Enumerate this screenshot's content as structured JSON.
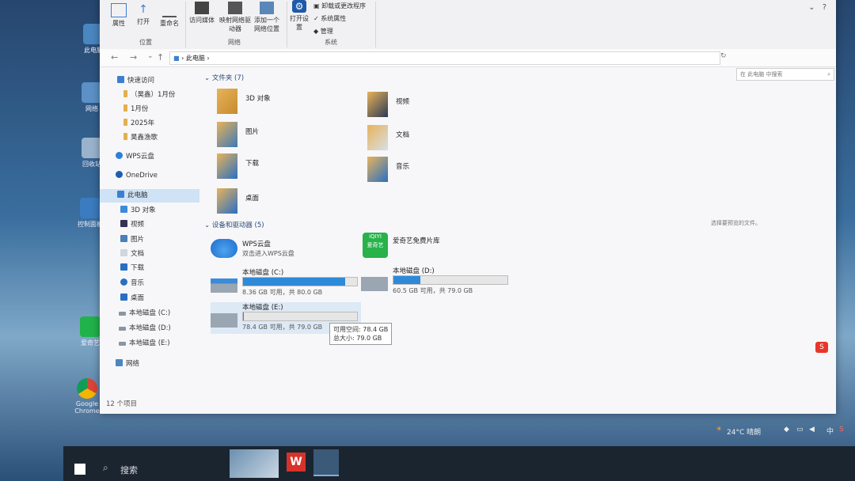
{
  "desktop": {
    "icons": [
      "此电脑",
      "网络",
      "回收站",
      "控制面板",
      "爱奇艺",
      "Google Chrome"
    ]
  },
  "ribbon": {
    "buttons": [
      "属性",
      "打开",
      "重命名",
      "访问媒体",
      "映射网络驱动器",
      "添加一个网络位置",
      "打开设置"
    ],
    "small_items": [
      "卸载或更改程序",
      "系统属性",
      "管理"
    ],
    "groups": [
      "位置",
      "网络",
      "系统"
    ]
  },
  "address_bar": {
    "path": [
      "此电脑"
    ],
    "search_placeholder": "在 此电脑 中搜索"
  },
  "nav_pane": {
    "items": [
      {
        "label": "快速访问",
        "icon": "star-icon"
      },
      {
        "label": "（昊鑫）1月份",
        "icon": "folder-icon"
      },
      {
        "label": "1月份",
        "icon": "folder-icon"
      },
      {
        "label": "2025年",
        "icon": "folder-icon"
      },
      {
        "label": "昊鑫渔歌",
        "icon": "folder-icon"
      },
      {
        "label": "WPS云盘",
        "icon": "cloud-icon"
      },
      {
        "label": "OneDrive",
        "icon": "cloud-icon"
      },
      {
        "label": "此电脑",
        "icon": "computer-icon",
        "selected": true
      },
      {
        "label": "3D 对象",
        "icon": "cube-icon"
      },
      {
        "label": "视频",
        "icon": "video-icon"
      },
      {
        "label": "图片",
        "icon": "picture-icon"
      },
      {
        "label": "文档",
        "icon": "document-icon"
      },
      {
        "label": "下载",
        "icon": "download-icon"
      },
      {
        "label": "音乐",
        "icon": "music-icon"
      },
      {
        "label": "桌面",
        "icon": "desktop-icon"
      },
      {
        "label": "本地磁盘 (C:)",
        "icon": "drive-icon"
      },
      {
        "label": "本地磁盘 (D:)",
        "icon": "drive-icon"
      },
      {
        "label": "本地磁盘 (E:)",
        "icon": "drive-icon"
      },
      {
        "label": "网络",
        "icon": "network-icon"
      }
    ]
  },
  "folders_section": {
    "header": "文件夹 (7)",
    "items": [
      "3D 对象",
      "视频",
      "图片",
      "文档",
      "下载",
      "音乐",
      "桌面"
    ]
  },
  "devices_section": {
    "header": "设备和驱动器 (5)",
    "wps": {
      "name": "WPS云盘",
      "sub": "双击进入WPS云盘"
    },
    "iqiyi": {
      "name": "爱奇艺免费片库",
      "logo_text": "iQIYI",
      "logo_sub": "爱奇艺"
    },
    "drives": [
      {
        "name": "本地磁盘 (C:)",
        "info": "8.36 GB 可用，共 80.0 GB",
        "used_fraction": 0.895
      },
      {
        "name": "本地磁盘 (D:)",
        "info": "60.5 GB 可用，共 79.0 GB",
        "used_fraction": 0.234
      },
      {
        "name": "本地磁盘 (E:)",
        "info": "78.4 GB 可用，共 79.0 GB",
        "used_fraction": 0.008
      }
    ]
  },
  "tooltip": {
    "line1": "可用空间: 78.4 GB",
    "line2": "总大小: 79.0 GB"
  },
  "status_bar": {
    "count": "12 个项目"
  },
  "preview_pane": {
    "text": "选择要预览的文件。"
  },
  "taskbar": {
    "search_label": "搜索",
    "weather": "24°C 晴朗",
    "ime": "中"
  },
  "colors": {
    "accent": "#2e8ad8",
    "selection": "#cfe2f6"
  }
}
